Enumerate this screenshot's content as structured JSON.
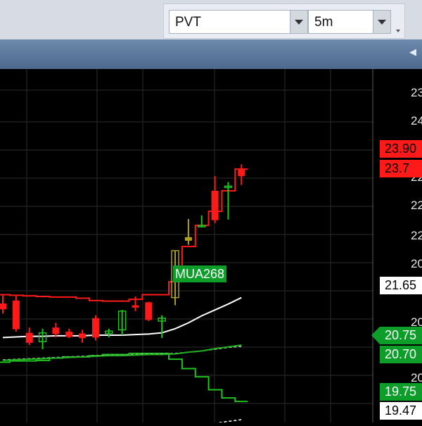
{
  "toolbar": {
    "symbol": "PVT",
    "interval": "5m"
  },
  "chart_data": {
    "type": "candlestick",
    "price_axis_ticks": [
      "23",
      "24",
      "23",
      "22",
      "22",
      "22",
      "20",
      "20",
      "20"
    ],
    "price_labels": [
      {
        "text": "23.90",
        "value": 23.9,
        "bg": "#ff1a1a",
        "fg": "#000000"
      },
      {
        "text": "23.7",
        "value": 23.7,
        "bg": "#ff1a1a",
        "fg": "#000000"
      },
      {
        "text": "21.65",
        "value": 21.65,
        "bg": "#ffffff",
        "fg": "#000000"
      },
      {
        "text": "20.75",
        "value": 20.75,
        "bg": "#0d9e2a",
        "fg": "#ffffff"
      },
      {
        "text": "20.70",
        "value": 20.7,
        "bg": "#0d9e2a",
        "fg": "#ffffff"
      },
      {
        "text": "19.75",
        "value": 19.75,
        "bg": "#0d9e2a",
        "fg": "#ffffff"
      },
      {
        "text": "19.47",
        "value": 19.47,
        "bg": "#ffffff",
        "fg": "#000000"
      }
    ],
    "annotation": {
      "text": "MUA268",
      "value": 21.82,
      "bg": "#0d9e2a",
      "fg": "#ffffff"
    },
    "candles": [
      {
        "o": 21.53,
        "h": 21.68,
        "l": 21.36,
        "c": 21.43
      },
      {
        "o": 21.58,
        "h": 21.66,
        "l": 21.05,
        "c": 21.09
      },
      {
        "o": 21.03,
        "h": 21.12,
        "l": 20.82,
        "c": 20.86
      },
      {
        "o": 20.88,
        "h": 21.1,
        "l": 20.75,
        "c": 21.03
      },
      {
        "o": 21.12,
        "h": 21.2,
        "l": 20.95,
        "c": 21.01
      },
      {
        "o": 21.05,
        "h": 21.1,
        "l": 20.94,
        "c": 20.96
      },
      {
        "o": 21.02,
        "h": 21.08,
        "l": 20.86,
        "c": 20.94
      },
      {
        "o": 21.28,
        "h": 21.33,
        "l": 20.9,
        "c": 20.95
      },
      {
        "o": 21.02,
        "h": 21.1,
        "l": 20.95,
        "c": 21.06
      },
      {
        "o": 21.08,
        "h": 21.42,
        "l": 20.99,
        "c": 21.4
      },
      {
        "o": 21.5,
        "h": 21.65,
        "l": 21.4,
        "c": 21.46
      },
      {
        "o": 21.55,
        "h": 21.56,
        "l": 21.23,
        "c": 21.25
      },
      {
        "o": 21.23,
        "h": 21.33,
        "l": 20.94,
        "c": 21.28
      },
      {
        "o": 21.63,
        "h": 22.43,
        "l": 21.5,
        "c": 22.43
      },
      {
        "o": 22.66,
        "h": 22.97,
        "l": 22.53,
        "c": 22.6
      },
      {
        "o": 22.86,
        "h": 23.03,
        "l": 22.83,
        "c": 22.86
      },
      {
        "o": 23.45,
        "h": 23.7,
        "l": 22.9,
        "c": 22.95
      },
      {
        "o": 23.53,
        "h": 23.6,
        "l": 22.96,
        "c": 23.53
      },
      {
        "o": 23.82,
        "h": 23.9,
        "l": 23.55,
        "c": 23.7
      }
    ],
    "series": [
      {
        "name": "",
        "color": "#ff1a1a",
        "style": "step",
        "values": [
          21.68,
          21.67,
          21.66,
          21.65,
          21.64,
          21.64,
          21.62,
          21.58,
          21.57,
          21.57,
          21.6,
          21.68,
          21.68,
          21.9,
          22.5,
          22.86,
          23.1,
          23.45,
          23.82
        ]
      },
      {
        "name": "",
        "color": "#ffffff",
        "style": "line",
        "values": [
          20.95,
          20.96,
          20.97,
          20.97,
          20.98,
          20.98,
          20.98,
          20.99,
          20.99,
          20.99,
          21.0,
          21.01,
          21.03,
          21.1,
          21.2,
          21.32,
          21.42,
          21.52,
          21.63
        ]
      },
      {
        "name": "",
        "color": "#1fc21f",
        "style": "step",
        "values": [
          20.53,
          20.55,
          20.55,
          20.56,
          20.6,
          20.62,
          20.62,
          20.64,
          20.66,
          20.66,
          20.68,
          20.68,
          20.68,
          20.58,
          20.42,
          20.28,
          20.06,
          19.92,
          19.86
        ]
      },
      {
        "name": "",
        "color": "#cccccc",
        "style": "dashed",
        "values": [
          20.57,
          20.58,
          20.59,
          20.6,
          20.61,
          20.62,
          20.63,
          20.64,
          20.65,
          20.65,
          20.66,
          20.67,
          20.67,
          20.68,
          20.7,
          20.72,
          20.75,
          20.78,
          20.8
        ]
      },
      {
        "name": "",
        "color": "#22b022",
        "style": "line",
        "values": [
          20.56,
          20.57,
          20.58,
          20.59,
          20.6,
          20.61,
          20.62,
          20.63,
          20.64,
          20.64,
          20.65,
          20.66,
          20.66,
          20.67,
          20.7,
          20.72,
          20.76,
          20.79,
          20.82
        ]
      },
      {
        "name": "",
        "color": "#ffffff",
        "style": "dashed",
        "values": [
          19.3,
          19.31,
          19.32,
          19.32,
          19.33,
          19.34,
          19.35,
          19.36,
          19.37,
          19.38,
          19.39,
          19.4,
          19.41,
          19.43,
          19.45,
          19.47,
          19.49,
          19.52,
          19.55
        ]
      }
    ],
    "grid": true
  }
}
